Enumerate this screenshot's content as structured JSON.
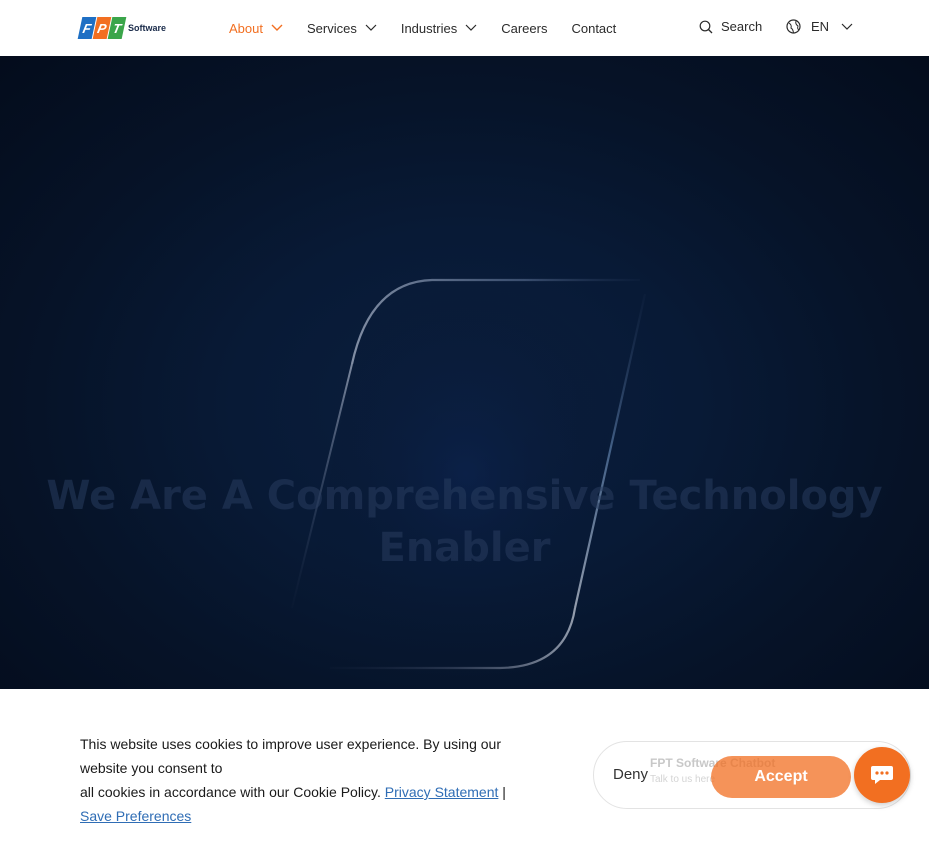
{
  "header": {
    "logo": {
      "letters": [
        "F",
        "P",
        "T"
      ],
      "word": "Software"
    },
    "nav": [
      {
        "label": "About",
        "has_dropdown": true,
        "active": true
      },
      {
        "label": "Services",
        "has_dropdown": true,
        "active": false
      },
      {
        "label": "Industries",
        "has_dropdown": true,
        "active": false
      },
      {
        "label": "Careers",
        "has_dropdown": false,
        "active": false
      },
      {
        "label": "Contact",
        "has_dropdown": false,
        "active": false
      }
    ],
    "search_label": "Search",
    "language": "EN"
  },
  "hero": {
    "title_line1": "We Are A Comprehensive Technology",
    "title_line2": "Enabler"
  },
  "cookie": {
    "text_line1": "This website uses cookies to improve user experience. By using our website you consent to",
    "text_line2": "all cookies in accordance with our Cookie Policy.",
    "privacy_link": "Privacy Statement",
    "separator": "|",
    "preferences_link": "Save Preferences",
    "deny_label": "Deny",
    "accept_label": "Accept"
  },
  "chatbot": {
    "title": "FPT Software Chatbot",
    "subtitle": "Talk to us here",
    "icon": "chat-bubble-icon"
  },
  "colors": {
    "brand_orange": "#f26f21",
    "brand_blue": "#1e6fc4",
    "brand_green": "#3aa54a",
    "hero_bg": "#061328",
    "link_blue": "#2f6db5"
  }
}
